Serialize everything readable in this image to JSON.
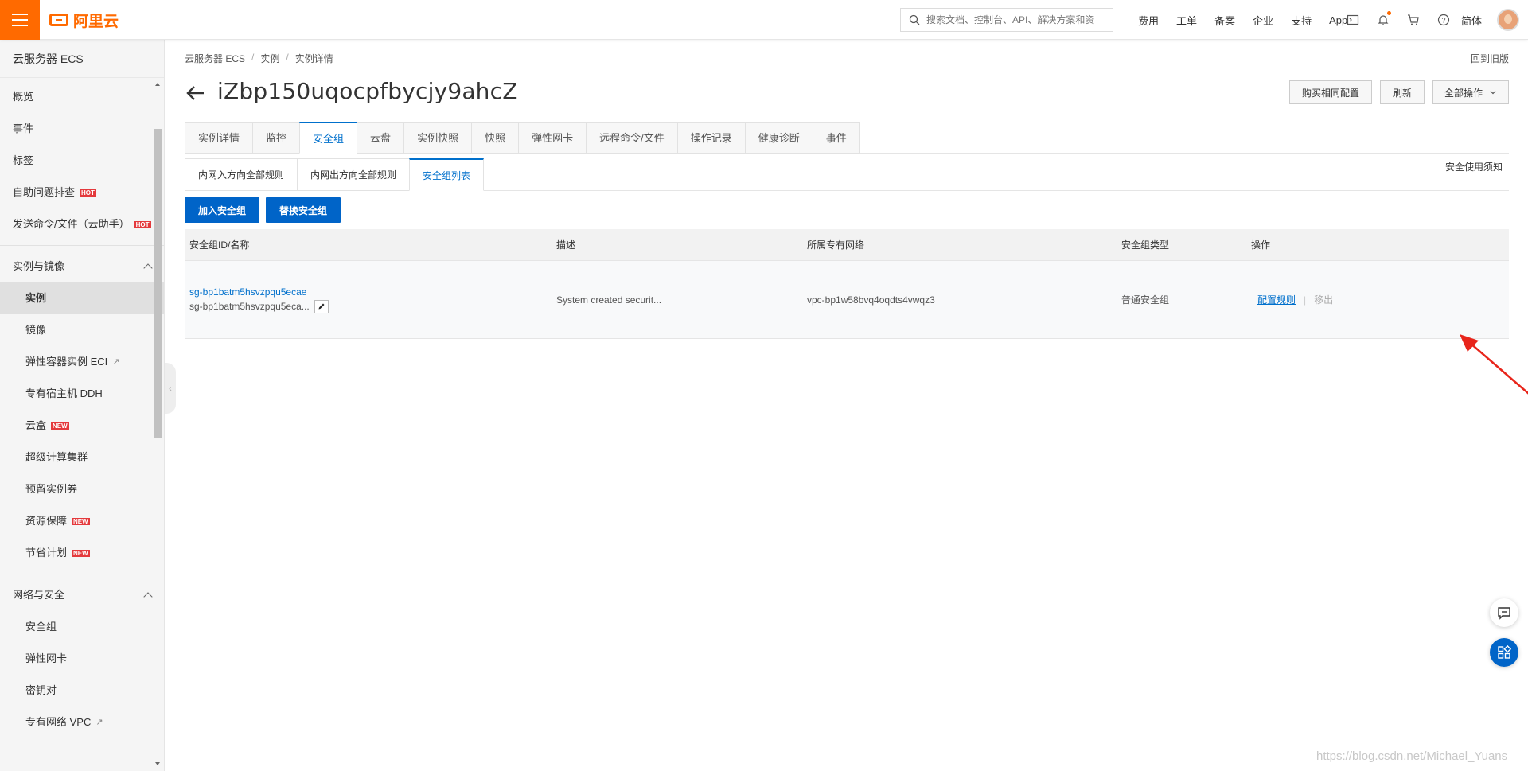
{
  "header": {
    "logo_text": "阿里云",
    "search_placeholder": "搜索文档、控制台、API、解决方案和资",
    "links": [
      "费用",
      "工单",
      "备案",
      "企业",
      "支持",
      "App"
    ],
    "lang": "简体",
    "icons": [
      "terminal-icon",
      "bell-icon",
      "cart-icon",
      "help-icon"
    ]
  },
  "sidebar": {
    "title": "云服务器 ECS",
    "top_items": [
      {
        "label": "概览"
      },
      {
        "label": "事件"
      },
      {
        "label": "标签"
      },
      {
        "label": "自助问题排查",
        "badge": "HOT"
      },
      {
        "label": "发送命令/文件（云助手）",
        "badge": "HOT"
      }
    ],
    "group1": {
      "label": "实例与镜像",
      "items": [
        {
          "label": "实例"
        },
        {
          "label": "镜像"
        },
        {
          "label": "弹性容器实例 ECI"
        },
        {
          "label": "专有宿主机 DDH"
        },
        {
          "label": "云盒",
          "badge": "NEW"
        },
        {
          "label": "超级计算集群"
        },
        {
          "label": "预留实例券"
        },
        {
          "label": "资源保障",
          "badge": "NEW"
        },
        {
          "label": "节省计划",
          "badge": "NEW"
        }
      ]
    },
    "group2": {
      "label": "网络与安全",
      "items": [
        {
          "label": "安全组"
        },
        {
          "label": "弹性网卡"
        },
        {
          "label": "密钥对"
        },
        {
          "label": "专有网络 VPC"
        }
      ]
    }
  },
  "breadcrumb": [
    "云服务器 ECS",
    "实例",
    "实例详情"
  ],
  "old_version": "回到旧版",
  "page_title": "iZbp150uqocpfbycjy9ahcZ",
  "actions": {
    "buy_same": "购买相同配置",
    "refresh": "刷新",
    "all_ops": "全部操作"
  },
  "tabs": [
    "实例详情",
    "监控",
    "安全组",
    "云盘",
    "实例快照",
    "快照",
    "弹性网卡",
    "远程命令/文件",
    "操作记录",
    "健康诊断",
    "事件"
  ],
  "active_tab": "安全组",
  "subtabs": [
    "内网入方向全部规则",
    "内网出方向全部规则",
    "安全组列表"
  ],
  "active_subtab": "安全组列表",
  "notice": "安全使用须知",
  "buttons": {
    "join_sg": "加入安全组",
    "replace_sg": "替换安全组"
  },
  "table": {
    "headers": [
      "安全组ID/名称",
      "描述",
      "所属专有网络",
      "安全组类型",
      "操作"
    ],
    "rows": [
      {
        "id": "sg-bp1batm5hsvzpqu5ecae",
        "name": "sg-bp1batm5hsvzpqu5eca...",
        "desc": "System created securit...",
        "vpc": "vpc-bp1w58bvq4oqdts4vwqz3",
        "type": "普通安全组",
        "op_config": "配置规则",
        "op_remove": "移出"
      }
    ]
  },
  "watermark": "https://blog.csdn.net/Michael_Yuans",
  "colors": {
    "brand": "#ff6a00",
    "primary": "#0064c8",
    "link": "#0070cc",
    "annotation_arrow": "#e8251b"
  }
}
